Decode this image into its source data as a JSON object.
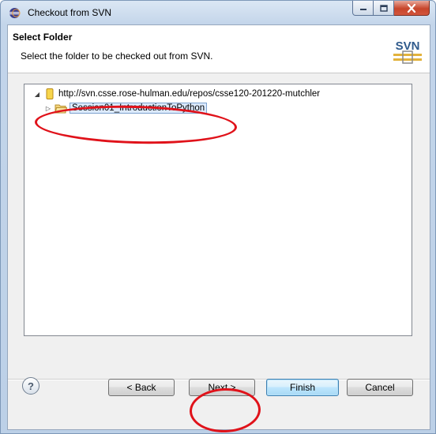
{
  "window": {
    "title": "Checkout from SVN",
    "minimize_symbol": "–",
    "maximize_symbol": "□",
    "close_symbol": "X"
  },
  "header": {
    "title": "Select Folder",
    "description": "Select the folder to be checked out from SVN.",
    "logo_text": "SVN"
  },
  "tree": {
    "items": [
      {
        "label": "http://svn.csse.rose-hulman.edu/repos/csse120-201220-mutchler",
        "expander": "◢",
        "icon": "repository-icon"
      },
      {
        "label": "Session01_IntroductionToPython",
        "expander": "▷",
        "icon": "folder-open-icon",
        "selected": true
      }
    ]
  },
  "footer": {
    "help_symbol": "?",
    "back_label": "< Back",
    "next_label": "Next >",
    "finish_label": "Finish",
    "cancel_label": "Cancel"
  },
  "colors": {
    "annotation": "#e0121a",
    "selection": "#dceafc",
    "default_button_border": "#3c7fb1"
  }
}
